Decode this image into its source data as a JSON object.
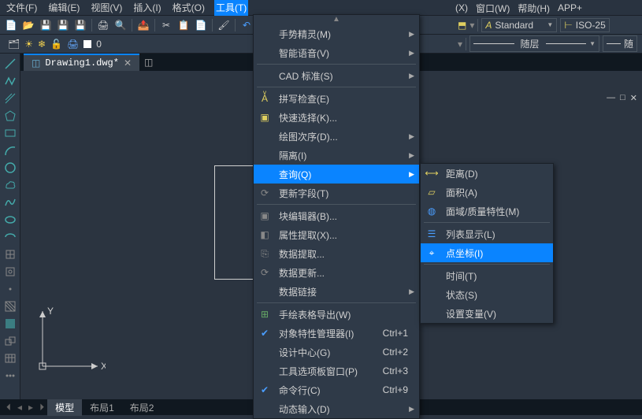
{
  "menubar": {
    "file": "文件(F)",
    "edit": "编辑(E)",
    "view": "视图(V)",
    "insert": "插入(I)",
    "format": "格式(O)",
    "tools": "工具(T)",
    "other1": "(X)",
    "window": "窗口(W)",
    "help": "帮助(H)",
    "app": "APP+"
  },
  "tab": {
    "name": "Drawing1.dwg*"
  },
  "style": {
    "text": "Standard",
    "dim": "ISO-25"
  },
  "layerline": "随层",
  "layer": {
    "name": "0"
  },
  "status": {
    "model": "模型",
    "lay1": "布局1",
    "lay2": "布局2"
  },
  "axis": {
    "x": "X",
    "y": "Y"
  },
  "tools_menu": {
    "gesture": "手势精灵(M)",
    "voice": "智能语音(V)",
    "cadstd": "CAD 标准(S)",
    "spell": "拼写检查(E)",
    "qselect": "快速选择(K)...",
    "draworder": "绘图次序(D)...",
    "isolate": "隔离(I)",
    "inquiry": "查询(Q)",
    "updfield": "更新字段(T)",
    "bedit": "块编辑器(B)...",
    "attext": "属性提取(X)...",
    "dataext": "数据提取...",
    "dataupd": "数据更新...",
    "datalink": "数据链接",
    "tableexp": "手绘表格导出(W)",
    "props": "对象特性管理器(I)",
    "dcenter": "设计中心(G)",
    "toolpal": "工具选项板窗口(P)",
    "cmdline": "命令行(C)",
    "dyninput": "动态输入(D)",
    "sc_props": "Ctrl+1",
    "sc_dc": "Ctrl+2",
    "sc_tp": "Ctrl+3",
    "sc_cmd": "Ctrl+9"
  },
  "inquiry_menu": {
    "dist": "距离(D)",
    "area": "面积(A)",
    "massprop": "面域/质量特性(M)",
    "list": "列表显示(L)",
    "id": "点坐标(I)",
    "time": "时间(T)",
    "status": "状态(S)",
    "setvar": "设置变量(V)"
  }
}
